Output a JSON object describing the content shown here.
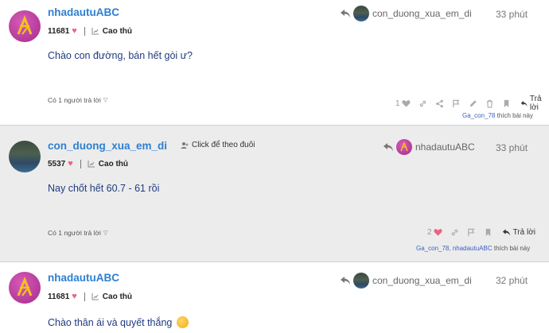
{
  "posts": [
    {
      "username": "nhadautuABC",
      "points": "11681",
      "rank": "Cao thủ",
      "reply_to_user": "con_duong_xua_em_di",
      "time": "33 phút",
      "content": "Chào con đường, bán hết gòi ư?",
      "replies_toggle": "Có 1 người trả lời",
      "like_count": "1",
      "reply_label": "Trả lời",
      "liked_by_names": "Ga_con_78",
      "liked_by_suffix": "thích bài này"
    },
    {
      "username": "con_duong_xua_em_di",
      "follow_label": "Click để theo đuôi",
      "points": "5537",
      "rank": "Cao thủ",
      "reply_to_user": "nhadautuABC",
      "time": "33 phút",
      "content": "Nay chốt hết 60.7 - 61 rồi",
      "replies_toggle": "Có 1 người trả lời",
      "like_count": "2",
      "reply_label": "Trả lời",
      "liked_by_names": "Ga_con_78, nhadautuABC",
      "liked_by_suffix": "thích bài này"
    },
    {
      "username": "nhadautuABC",
      "points": "11681",
      "rank": "Cao thủ",
      "reply_to_user": "con_duong_xua_em_di",
      "time": "32 phút",
      "content": "Chào thân ái và quyết thắng",
      "emoji": "rolling-on-floor-laughing-emoji"
    }
  ],
  "colors": {
    "username": "#2f7fd0",
    "content": "#1f3b80",
    "heart": "#e8657e",
    "selected_bg": "#ececec",
    "divider": "#c9d4e0"
  }
}
